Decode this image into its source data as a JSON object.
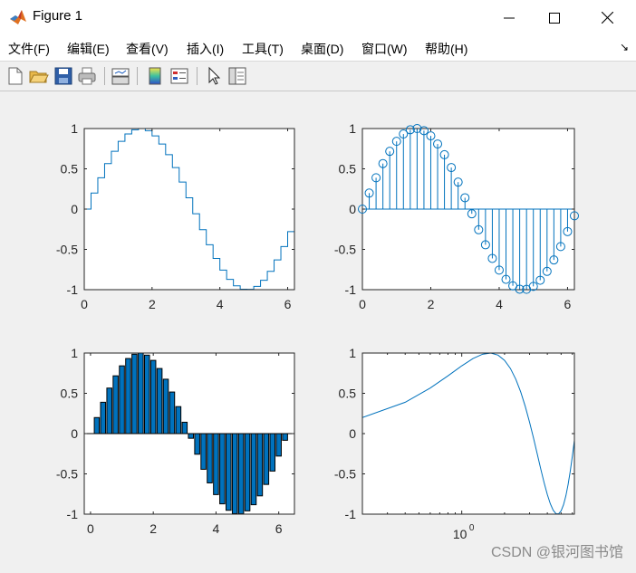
{
  "window": {
    "title": "Figure 1"
  },
  "menu": [
    {
      "label": "文件(F)"
    },
    {
      "label": "编辑(E)"
    },
    {
      "label": "查看(V)"
    },
    {
      "label": "插入(I)"
    },
    {
      "label": "工具(T)"
    },
    {
      "label": "桌面(D)"
    },
    {
      "label": "窗口(W)"
    },
    {
      "label": "帮助(H)"
    }
  ],
  "toolbar_icons": [
    "new-figure-icon",
    "open-file-icon",
    "save-icon",
    "print-icon",
    "link-plot-icon",
    "insert-colorbar-icon",
    "insert-legend-icon",
    "edit-plot-icon",
    "property-inspector-icon"
  ],
  "colors": {
    "series": "#0072bd",
    "bar_fill": "#0072bd",
    "axes": "#262626",
    "background": "#f0f0f0"
  },
  "watermark": "CSDN @银河图书馆",
  "chart_data": [
    {
      "type": "line",
      "variant": "stairs",
      "x": [
        0.0,
        0.2,
        0.4,
        0.6,
        0.8,
        1.0,
        1.2,
        1.4,
        1.6,
        1.8,
        2.0,
        2.2,
        2.4,
        2.6,
        2.8,
        3.0,
        3.2,
        3.4,
        3.6,
        3.8,
        4.0,
        4.2,
        4.4,
        4.6,
        4.8,
        5.0,
        5.2,
        5.4,
        5.6,
        5.8,
        6.0,
        6.2
      ],
      "y": [
        0.0,
        0.199,
        0.389,
        0.565,
        0.717,
        0.841,
        0.932,
        0.985,
        1.0,
        0.974,
        0.909,
        0.808,
        0.675,
        0.516,
        0.335,
        0.141,
        -0.058,
        -0.256,
        -0.443,
        -0.612,
        -0.757,
        -0.872,
        -0.952,
        -0.994,
        -0.996,
        -0.959,
        -0.883,
        -0.773,
        -0.631,
        -0.465,
        -0.279,
        -0.083
      ],
      "xlim": [
        0,
        6.2
      ],
      "ylim": [
        -1,
        1
      ],
      "xticks": [
        "0",
        "2",
        "4",
        "6"
      ],
      "yticks": [
        "1",
        "0.5",
        "0",
        "-0.5",
        "-1"
      ]
    },
    {
      "type": "scatter",
      "variant": "stem",
      "x": [
        0.0,
        0.2,
        0.4,
        0.6,
        0.8,
        1.0,
        1.2,
        1.4,
        1.6,
        1.8,
        2.0,
        2.2,
        2.4,
        2.6,
        2.8,
        3.0,
        3.2,
        3.4,
        3.6,
        3.8,
        4.0,
        4.2,
        4.4,
        4.6,
        4.8,
        5.0,
        5.2,
        5.4,
        5.6,
        5.8,
        6.0,
        6.2
      ],
      "y": [
        0.0,
        0.199,
        0.389,
        0.565,
        0.717,
        0.841,
        0.932,
        0.985,
        1.0,
        0.974,
        0.909,
        0.808,
        0.675,
        0.516,
        0.335,
        0.141,
        -0.058,
        -0.256,
        -0.443,
        -0.612,
        -0.757,
        -0.872,
        -0.952,
        -0.994,
        -0.996,
        -0.959,
        -0.883,
        -0.773,
        -0.631,
        -0.465,
        -0.279,
        -0.083
      ],
      "xlim": [
        0,
        6.2
      ],
      "ylim": [
        -1,
        1
      ],
      "xticks": [
        "0",
        "2",
        "4",
        "6"
      ],
      "yticks": [
        "1",
        "0.5",
        "0",
        "-0.5",
        "-1"
      ]
    },
    {
      "type": "bar",
      "x": [
        0.2,
        0.4,
        0.6,
        0.8,
        1.0,
        1.2,
        1.4,
        1.6,
        1.8,
        2.0,
        2.2,
        2.4,
        2.6,
        2.8,
        3.0,
        3.2,
        3.4,
        3.6,
        3.8,
        4.0,
        4.2,
        4.4,
        4.6,
        4.8,
        5.0,
        5.2,
        5.4,
        5.6,
        5.8,
        6.0,
        6.2
      ],
      "y": [
        0.199,
        0.389,
        0.565,
        0.717,
        0.841,
        0.932,
        0.985,
        1.0,
        0.974,
        0.909,
        0.808,
        0.675,
        0.516,
        0.335,
        0.141,
        -0.058,
        -0.256,
        -0.443,
        -0.612,
        -0.757,
        -0.872,
        -0.952,
        -0.994,
        -0.996,
        -0.959,
        -0.883,
        -0.773,
        -0.631,
        -0.465,
        -0.279,
        -0.083
      ],
      "xlim": [
        -0.2,
        6.5
      ],
      "ylim": [
        -1,
        1
      ],
      "xticks": [
        "0",
        "2",
        "4",
        "6"
      ],
      "yticks": [
        "1",
        "0.5",
        "0",
        "-0.5",
        "-1"
      ]
    },
    {
      "type": "line",
      "xscale": "log",
      "x": [
        0.2,
        0.4,
        0.6,
        0.8,
        1.0,
        1.2,
        1.4,
        1.6,
        1.8,
        2.0,
        2.2,
        2.4,
        2.6,
        2.8,
        3.0,
        3.2,
        3.4,
        3.6,
        3.8,
        4.0,
        4.2,
        4.4,
        4.6,
        4.8,
        5.0,
        5.2,
        5.4,
        5.6,
        5.8,
        6.0,
        6.2
      ],
      "y": [
        0.199,
        0.389,
        0.565,
        0.717,
        0.841,
        0.932,
        0.985,
        1.0,
        0.974,
        0.909,
        0.808,
        0.675,
        0.516,
        0.335,
        0.141,
        -0.058,
        -0.256,
        -0.443,
        -0.612,
        -0.757,
        -0.872,
        -0.952,
        -0.994,
        -0.996,
        -0.959,
        -0.883,
        -0.773,
        -0.631,
        -0.465,
        -0.279,
        -0.083
      ],
      "xlim": [
        0.2,
        6.2
      ],
      "ylim": [
        -1,
        1
      ],
      "xtick_base": "10",
      "xtick_exp": "0",
      "yticks": [
        "1",
        "0.5",
        "0",
        "-0.5",
        "-1"
      ]
    }
  ]
}
